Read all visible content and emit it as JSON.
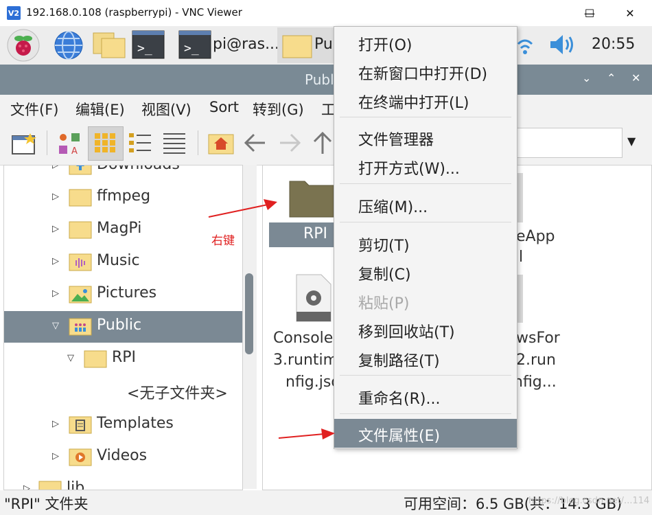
{
  "window": {
    "title": "192.168.0.108 (raspberrypi) - VNC Viewer",
    "logo": "V2",
    "minimize": "—",
    "maximize": "☐",
    "close": "✕"
  },
  "taskbar": {
    "terminal_label": "pi@ras...",
    "folder_label": "Pu",
    "clock": "20:55",
    "icons": [
      "raspberry-icon",
      "globe-icon",
      "folder-icon",
      "terminal-icon",
      "terminal-icon",
      "wifi-icon",
      "volume-icon"
    ]
  },
  "filemanager": {
    "title": "Publ",
    "ctl_down": "⌄",
    "ctl_up": "⌃",
    "ctl_close": "✕"
  },
  "menubar": [
    "文件(F)",
    "编辑(E)",
    "视图(V)",
    "Sort",
    "转到(G)",
    "工"
  ],
  "toolbar": {
    "dropdown": "▼"
  },
  "tree": [
    {
      "label": "Downloads",
      "arrow": "▷",
      "indent": 1,
      "icon": "download-folder-icon"
    },
    {
      "label": "ffmpeg",
      "arrow": "▷",
      "indent": 1,
      "icon": "folder-icon"
    },
    {
      "label": "MagPi",
      "arrow": "▷",
      "indent": 1,
      "icon": "folder-icon"
    },
    {
      "label": "Music",
      "arrow": "▷",
      "indent": 1,
      "icon": "music-folder-icon"
    },
    {
      "label": "Pictures",
      "arrow": "▷",
      "indent": 1,
      "icon": "pictures-folder-icon"
    },
    {
      "label": "Public",
      "arrow": "▽",
      "indent": 1,
      "icon": "public-folder-icon",
      "selected": true
    },
    {
      "label": "RPI",
      "arrow": "▽",
      "indent": 2,
      "icon": "folder-icon"
    },
    {
      "label": "<无子文件夹>",
      "arrow": "",
      "indent": 3,
      "icon": ""
    },
    {
      "label": "Templates",
      "arrow": "▷",
      "indent": 1,
      "icon": "templates-folder-icon"
    },
    {
      "label": "Videos",
      "arrow": "▷",
      "indent": 1,
      "icon": "videos-folder-icon"
    },
    {
      "label": "lib",
      "arrow": "▷",
      "indent": 0,
      "icon": "folder-icon"
    }
  ],
  "files": {
    "rpi": "RPI",
    "file_left_line1": "Console",
    "file_left_line2": "3.runtim",
    "file_left_line3": "nfig.jso",
    "file_right_top1": "eApp",
    "file_right_top2": "l",
    "file_right_line1": "wsFor",
    "file_right_line2": "2.run",
    "file_right_line3": "nfig..."
  },
  "context_menu": [
    {
      "label": "打开(O)"
    },
    {
      "label": "在新窗口中打开(D)"
    },
    {
      "label": "在终端中打开(L)"
    },
    {
      "sep": true
    },
    {
      "label": "文件管理器"
    },
    {
      "label": "打开方式(W)..."
    },
    {
      "sep": true
    },
    {
      "label": "压缩(M)..."
    },
    {
      "sep": true
    },
    {
      "label": "剪切(T)"
    },
    {
      "label": "复制(C)"
    },
    {
      "label": "粘贴(P)",
      "disabled": true
    },
    {
      "label": "移到回收站(T)"
    },
    {
      "label": "复制路径(T)"
    },
    {
      "sep": true
    },
    {
      "label": "重命名(R)..."
    },
    {
      "sep": true
    },
    {
      "label": "文件属性(E)",
      "highlighted": true
    }
  ],
  "annotation": "右键",
  "status": {
    "left": "\"RPI\" 文件夹",
    "right": "可用空间：6.5 GB(共：14.3 GB)",
    "watermark": "https://blog.csdn.net/...114"
  },
  "colors": {
    "selection": "#7b8994",
    "titlebar": "#7a8a95",
    "folder": "#f7dc8c",
    "arrow_red": "#e02020"
  }
}
